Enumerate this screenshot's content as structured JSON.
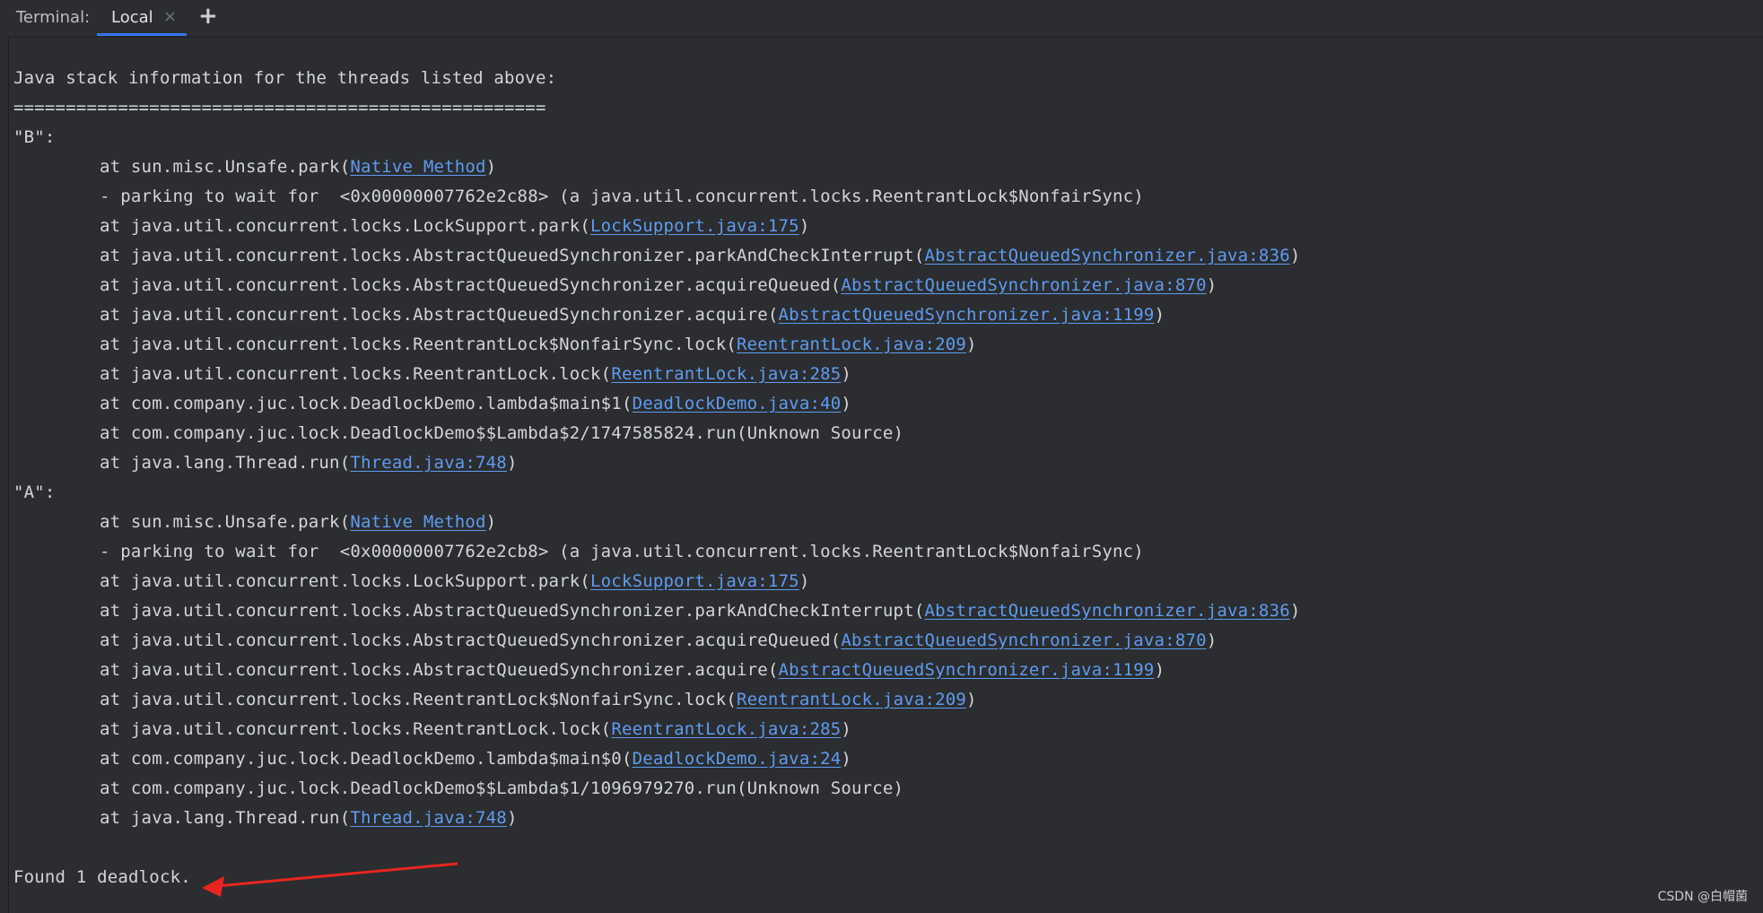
{
  "tabbar": {
    "title": "Terminal:",
    "tab_label": "Local",
    "close_glyph": "×",
    "add_glyph": "+"
  },
  "console": {
    "header": "Java stack information for the threads listed above:",
    "separator": "===================================================",
    "threads": [
      {
        "name": "\"B\":",
        "frames": [
          {
            "text": "at sun.misc.Unsafe.park(",
            "link": "Native Method",
            "tail": ")"
          },
          {
            "text": "- parking to wait for  <0x00000007762e2c88> (a java.util.concurrent.locks.ReentrantLock$NonfairSync)",
            "link": "",
            "tail": ""
          },
          {
            "text": "at java.util.concurrent.locks.LockSupport.park(",
            "link": "LockSupport.java:175",
            "tail": ")"
          },
          {
            "text": "at java.util.concurrent.locks.AbstractQueuedSynchronizer.parkAndCheckInterrupt(",
            "link": "AbstractQueuedSynchronizer.java:836",
            "tail": ")"
          },
          {
            "text": "at java.util.concurrent.locks.AbstractQueuedSynchronizer.acquireQueued(",
            "link": "AbstractQueuedSynchronizer.java:870",
            "tail": ")"
          },
          {
            "text": "at java.util.concurrent.locks.AbstractQueuedSynchronizer.acquire(",
            "link": "AbstractQueuedSynchronizer.java:1199",
            "tail": ")"
          },
          {
            "text": "at java.util.concurrent.locks.ReentrantLock$NonfairSync.lock(",
            "link": "ReentrantLock.java:209",
            "tail": ")"
          },
          {
            "text": "at java.util.concurrent.locks.ReentrantLock.lock(",
            "link": "ReentrantLock.java:285",
            "tail": ")"
          },
          {
            "text": "at com.company.juc.lock.DeadlockDemo.lambda$main$1(",
            "link": "DeadlockDemo.java:40",
            "tail": ")"
          },
          {
            "text": "at com.company.juc.lock.DeadlockDemo$$Lambda$2/1747585824.run(Unknown Source)",
            "link": "",
            "tail": ""
          },
          {
            "text": "at java.lang.Thread.run(",
            "link": "Thread.java:748",
            "tail": ")"
          }
        ]
      },
      {
        "name": "\"A\":",
        "frames": [
          {
            "text": "at sun.misc.Unsafe.park(",
            "link": "Native Method",
            "tail": ")"
          },
          {
            "text": "- parking to wait for  <0x00000007762e2cb8> (a java.util.concurrent.locks.ReentrantLock$NonfairSync)",
            "link": "",
            "tail": ""
          },
          {
            "text": "at java.util.concurrent.locks.LockSupport.park(",
            "link": "LockSupport.java:175",
            "tail": ")"
          },
          {
            "text": "at java.util.concurrent.locks.AbstractQueuedSynchronizer.parkAndCheckInterrupt(",
            "link": "AbstractQueuedSynchronizer.java:836",
            "tail": ")"
          },
          {
            "text": "at java.util.concurrent.locks.AbstractQueuedSynchronizer.acquireQueued(",
            "link": "AbstractQueuedSynchronizer.java:870",
            "tail": ")"
          },
          {
            "text": "at java.util.concurrent.locks.AbstractQueuedSynchronizer.acquire(",
            "link": "AbstractQueuedSynchronizer.java:1199",
            "tail": ")"
          },
          {
            "text": "at java.util.concurrent.locks.ReentrantLock$NonfairSync.lock(",
            "link": "ReentrantLock.java:209",
            "tail": ")"
          },
          {
            "text": "at java.util.concurrent.locks.ReentrantLock.lock(",
            "link": "ReentrantLock.java:285",
            "tail": ")"
          },
          {
            "text": "at com.company.juc.lock.DeadlockDemo.lambda$main$0(",
            "link": "DeadlockDemo.java:24",
            "tail": ")"
          },
          {
            "text": "at com.company.juc.lock.DeadlockDemo$$Lambda$1/1096979270.run(Unknown Source)",
            "link": "",
            "tail": ""
          },
          {
            "text": "at java.lang.Thread.run(",
            "link": "Thread.java:748",
            "tail": ")"
          }
        ]
      }
    ],
    "footer": "Found 1 deadlock."
  },
  "annotation": {
    "arrow_color": "#e8251f"
  },
  "watermark": "CSDN @白帽菌"
}
